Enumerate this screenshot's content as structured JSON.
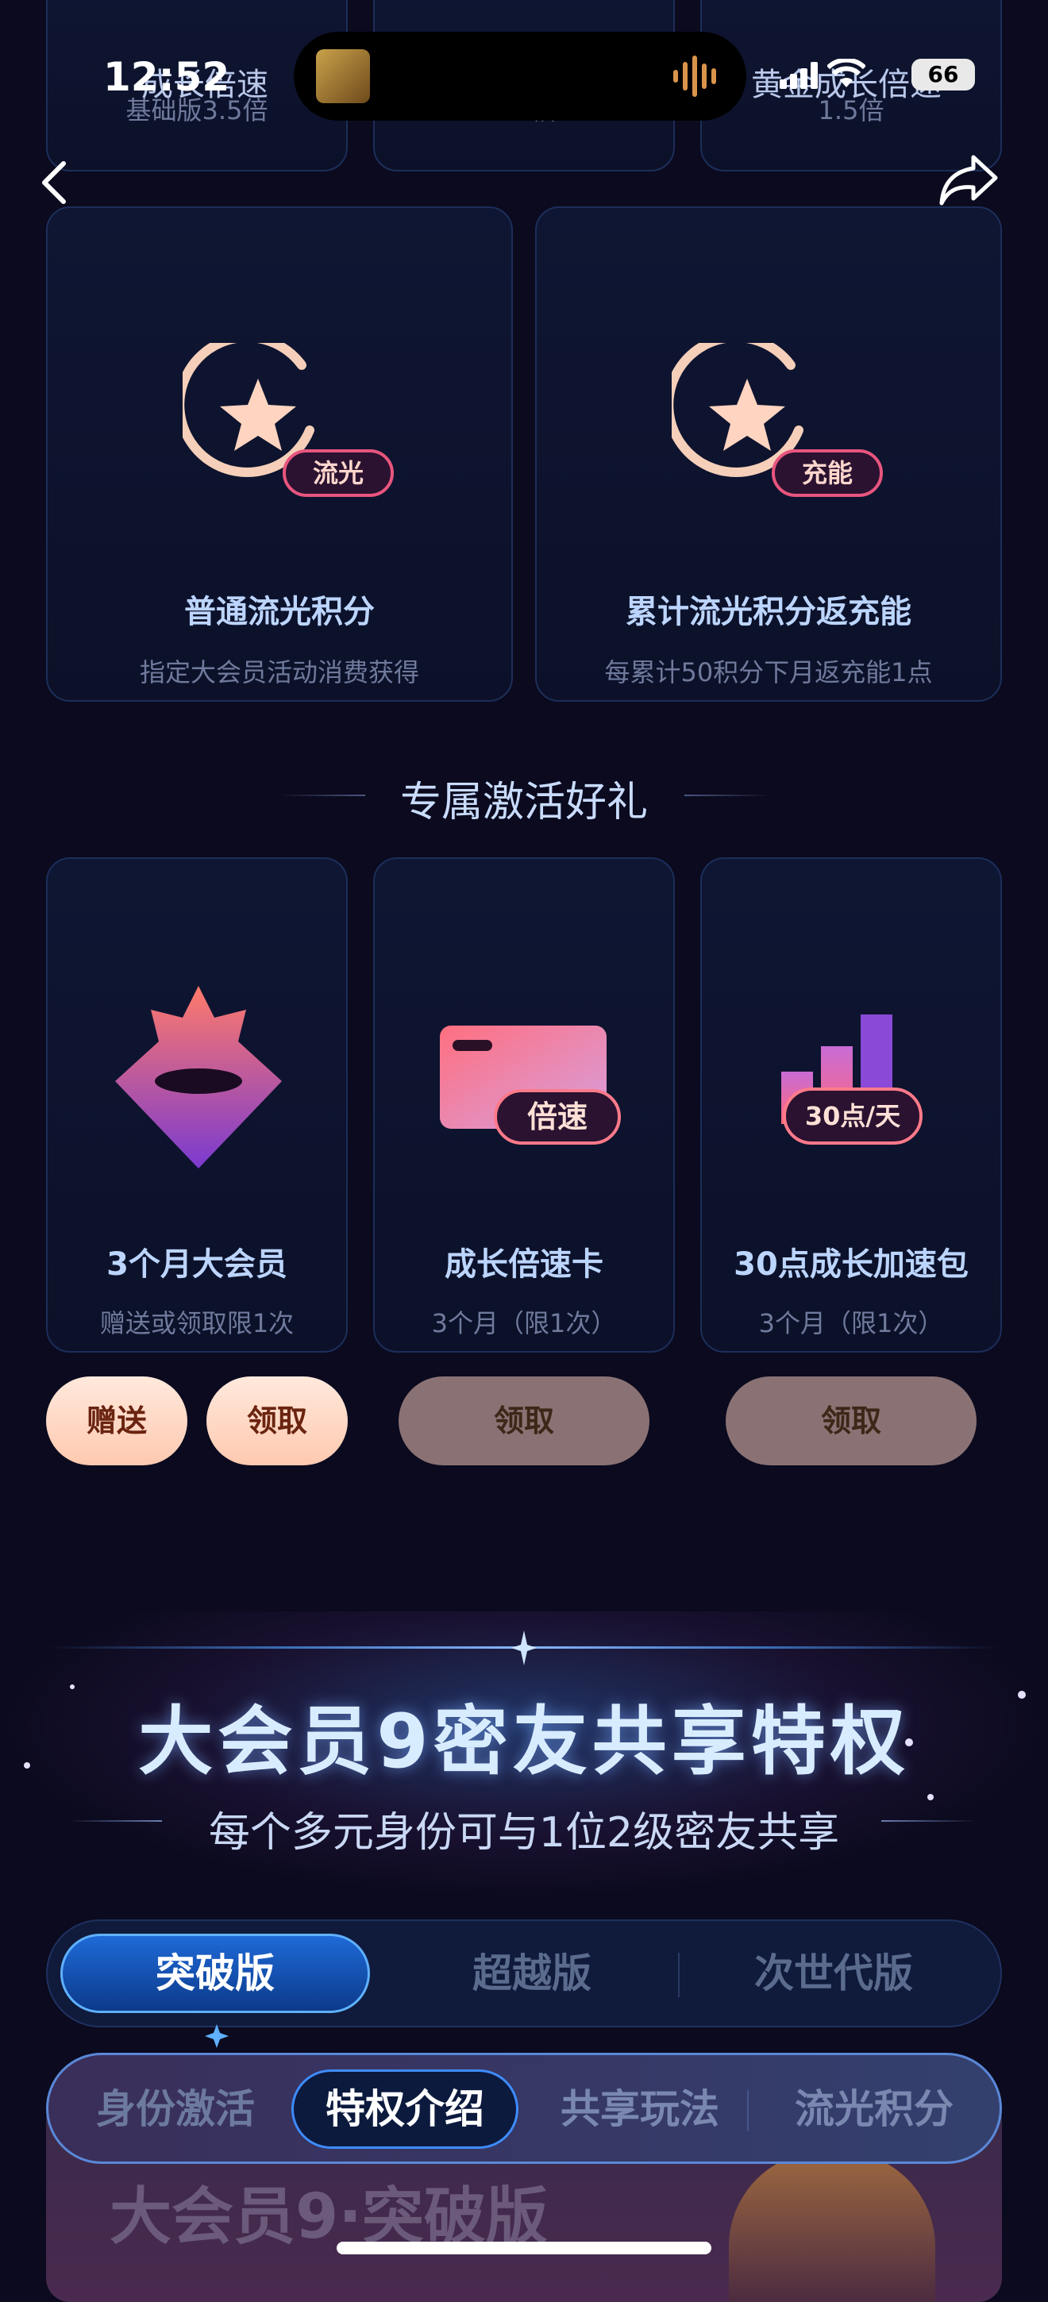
{
  "status_bar": {
    "time": "12:52",
    "battery": "66",
    "peek_left": "成长倍速",
    "peek_right": "黄金成长倍速"
  },
  "top_cards": [
    {
      "sub": "基础版3.5倍"
    },
    {
      "sub": "1.5倍"
    },
    {
      "sub": "1.5倍"
    }
  ],
  "points_cards": [
    {
      "badge": "流光",
      "title": "普通流光积分",
      "sub": "指定大会员活动消费获得"
    },
    {
      "badge": "充能",
      "title": "累计流光积分返充能",
      "sub": "每累计50积分下月返充能1点"
    }
  ],
  "gift_section_title": "专属激活好礼",
  "gift_cards": [
    {
      "title": "3个月大会员",
      "sub": "赠送或领取限1次"
    },
    {
      "badge": "倍速",
      "title": "成长倍速卡",
      "sub": "3个月（限1次）"
    },
    {
      "badge": "30点/天",
      "title": "30点成长加速包",
      "sub": "3个月（限1次）"
    }
  ],
  "gift_buttons": {
    "gift": "赠送",
    "claim1": "领取",
    "claim2": "领取",
    "claim3": "领取"
  },
  "share_banner": {
    "title": "大会员9密友共享特权",
    "subtitle": "每个多元身份可与1位2级密友共享"
  },
  "edition_tabs": [
    "突破版",
    "超越版",
    "次世代版"
  ],
  "feature_tabs": [
    "身份激活",
    "特权介绍",
    "共享玩法",
    "流光积分"
  ],
  "bottom_peek_title": "大会员9·突破版",
  "colors": {
    "accent_pink": "#e8557e",
    "card_border": "#1c2e5a",
    "button_light": "#ffd8c4"
  }
}
